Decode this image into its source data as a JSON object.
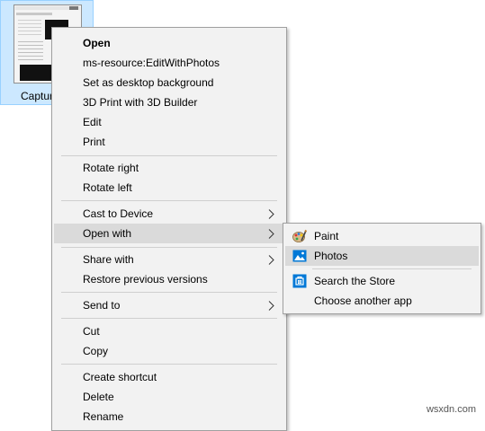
{
  "file": {
    "label": "Captur"
  },
  "menu": {
    "open": "Open",
    "edit_with_photos": "ms-resource:EditWithPhotos",
    "set_desktop_bg": "Set as desktop background",
    "print_3d": "3D Print with 3D Builder",
    "edit": "Edit",
    "print": "Print",
    "rotate_right": "Rotate right",
    "rotate_left": "Rotate left",
    "cast_to_device": "Cast to Device",
    "open_with": "Open with",
    "share_with": "Share with",
    "restore_previous": "Restore previous versions",
    "send_to": "Send to",
    "cut": "Cut",
    "copy": "Copy",
    "create_shortcut": "Create shortcut",
    "delete": "Delete",
    "rename": "Rename"
  },
  "submenu": {
    "paint": "Paint",
    "photos": "Photos",
    "search_store": "Search the Store",
    "choose_another": "Choose another app"
  },
  "colors": {
    "selection": "#cce8ff",
    "menu_bg": "#f2f2f2",
    "hover": "#dadada",
    "store_blue": "#0078d7"
  },
  "watermark": "wsxdn.com"
}
